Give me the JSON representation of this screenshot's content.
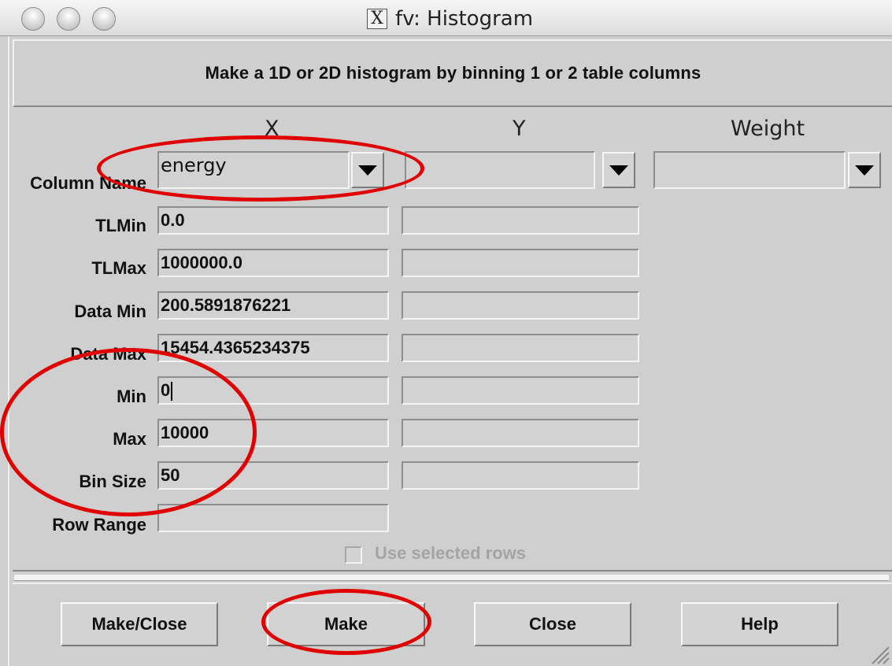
{
  "window": {
    "title": "fv: Histogram"
  },
  "description": "Make a 1D or 2D histogram by binning 1 or 2 table columns",
  "columns": {
    "x": "X",
    "y": "Y",
    "weight": "Weight"
  },
  "labels": {
    "column_name": "Column Name",
    "tlmin": "TLMin",
    "tlmax": "TLMax",
    "data_min": "Data Min",
    "data_max": "Data Max",
    "min": "Min",
    "max": "Max",
    "bin_size": "Bin Size",
    "row_range": "Row Range"
  },
  "x_values": {
    "column_name": "energy",
    "tlmin": "0.0",
    "tlmax": "1000000.0",
    "data_min": "200.5891876221",
    "data_max": "15454.4365234375",
    "min": "0",
    "max": "10000",
    "bin_size": "50",
    "row_range": ""
  },
  "y_values": {
    "column_name": ""
  },
  "weight_values": {
    "column_name": ""
  },
  "checkbox": {
    "label": "Use selected rows",
    "checked": false,
    "enabled": false
  },
  "buttons": {
    "make_close": "Make/Close",
    "make": "Make",
    "close": "Close",
    "help": "Help"
  },
  "annotation_color": "#e00000"
}
